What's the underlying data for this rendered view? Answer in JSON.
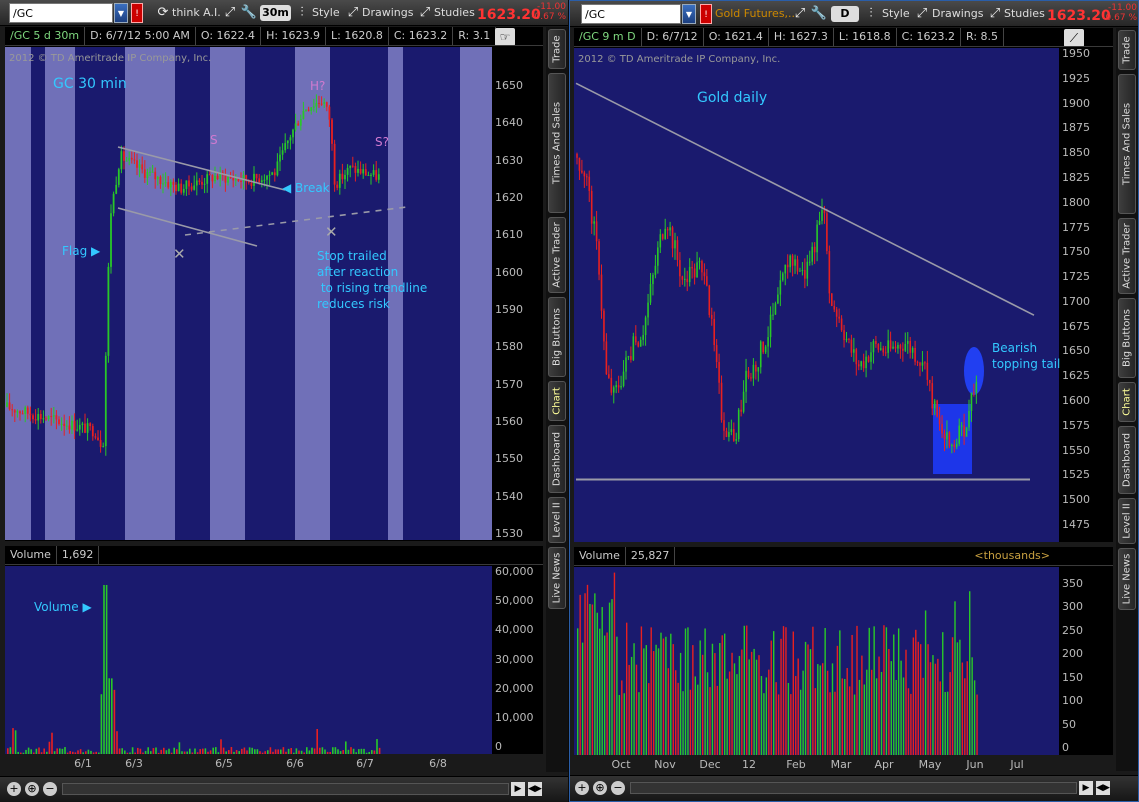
{
  "left": {
    "symbol": "/GC",
    "study": "think A.I.",
    "period": "30m",
    "style": "Style",
    "drawings": "Drawings",
    "studies": "Studies",
    "price": "1623.20",
    "change": "-11.00",
    "change_pct": "-0.67 %",
    "header": {
      "symbol": "/GC 5 d 30m",
      "date": "D: 6/7/12 5:00 AM",
      "open": "O: 1622.4",
      "high": "H: 1623.9",
      "low": "L: 1620.8",
      "close": "C: 1623.2",
      "range": "R: 3.1"
    },
    "copyright": "2012 © TD Ameritrade IP Company, Inc.",
    "price_axis": [
      "1650",
      "1640",
      "1630",
      "1620",
      "1610",
      "1600",
      "1590",
      "1580",
      "1570",
      "1560",
      "1550",
      "1540",
      "1530"
    ],
    "annotations": {
      "title": "GC 30 min",
      "flag": "Flag",
      "break": "Break",
      "s": "S",
      "h": "H?",
      "s2": "S?",
      "stop1": "Stop trailed",
      "stop2": "after reaction",
      "stop3": " to rising trendline",
      "stop4": "reduces risk",
      "volume_tag": "Volume"
    },
    "volume": {
      "label": "Volume",
      "value": "1,692",
      "axis": [
        "60,000",
        "50,000",
        "40,000",
        "30,000",
        "20,000",
        "10,000",
        "0"
      ]
    },
    "dates": [
      "6/1",
      "6/3",
      "6/5",
      "6/6",
      "6/7",
      "6/8"
    ],
    "side_tabs": [
      "Trade",
      "Times And Sales",
      "Active Trader",
      "Big Buttons",
      "Chart",
      "Dashboard",
      "Level II",
      "Live News"
    ],
    "chart_data": {
      "type": "candlestick",
      "symbol": "/GC",
      "interval": "30m",
      "ylim": [
        1530,
        1652
      ],
      "events": [
        {
          "x": "6/1",
          "desc": "Flag"
        },
        {
          "x": "6/5",
          "desc": "Break",
          "y": 1622
        }
      ]
    }
  },
  "right": {
    "symbol": "/GC",
    "desc": "Gold Futures,...",
    "period": "D",
    "style": "Style",
    "drawings": "Drawings",
    "studies": "Studies",
    "price": "1623.20",
    "change": "-11.00",
    "change_pct": "-0.67 %",
    "header": {
      "symbol": "/GC 9 m D",
      "date": "D: 6/7/12",
      "open": "O: 1621.4",
      "high": "H: 1627.3",
      "low": "L: 1618.8",
      "close": "C: 1623.2",
      "range": "R: 8.5"
    },
    "copyright": "2012 © TD Ameritrade IP Company, Inc.",
    "price_axis": [
      "1950",
      "1925",
      "1900",
      "1875",
      "1850",
      "1825",
      "1800",
      "1775",
      "1750",
      "1725",
      "1700",
      "1675",
      "1650",
      "1625",
      "1600",
      "1575",
      "1550",
      "1525",
      "1500",
      "1475"
    ],
    "annotations": {
      "title": "Gold daily",
      "bear1": "Bearish",
      "bear2": "topping tail"
    },
    "volume": {
      "label": "Volume",
      "value": "25,827",
      "unit": "<thousands>",
      "axis": [
        "350",
        "300",
        "250",
        "200",
        "150",
        "100",
        "50",
        "0"
      ]
    },
    "months": [
      "Oct",
      "Nov",
      "Dec",
      "12",
      "Feb",
      "Mar",
      "Apr",
      "May",
      "Jun",
      "Jul"
    ],
    "side_tabs": [
      "Trade",
      "Times And Sales",
      "Active Trader",
      "Big Buttons",
      "Chart",
      "Dashboard",
      "Level II",
      "Live News"
    ],
    "chart_data": {
      "type": "candlestick",
      "symbol": "/GC",
      "interval": "daily",
      "ylim": [
        1465,
        1955
      ],
      "support": 1527,
      "resistance_from": 1920,
      "resistance_to": 1690
    }
  },
  "colors": {
    "up": "#28c828",
    "down": "#e82020",
    "bg": "#1a1a6e",
    "band": "#7070b8",
    "trend": "#9a9aa8",
    "accent": "#33c8ff"
  }
}
